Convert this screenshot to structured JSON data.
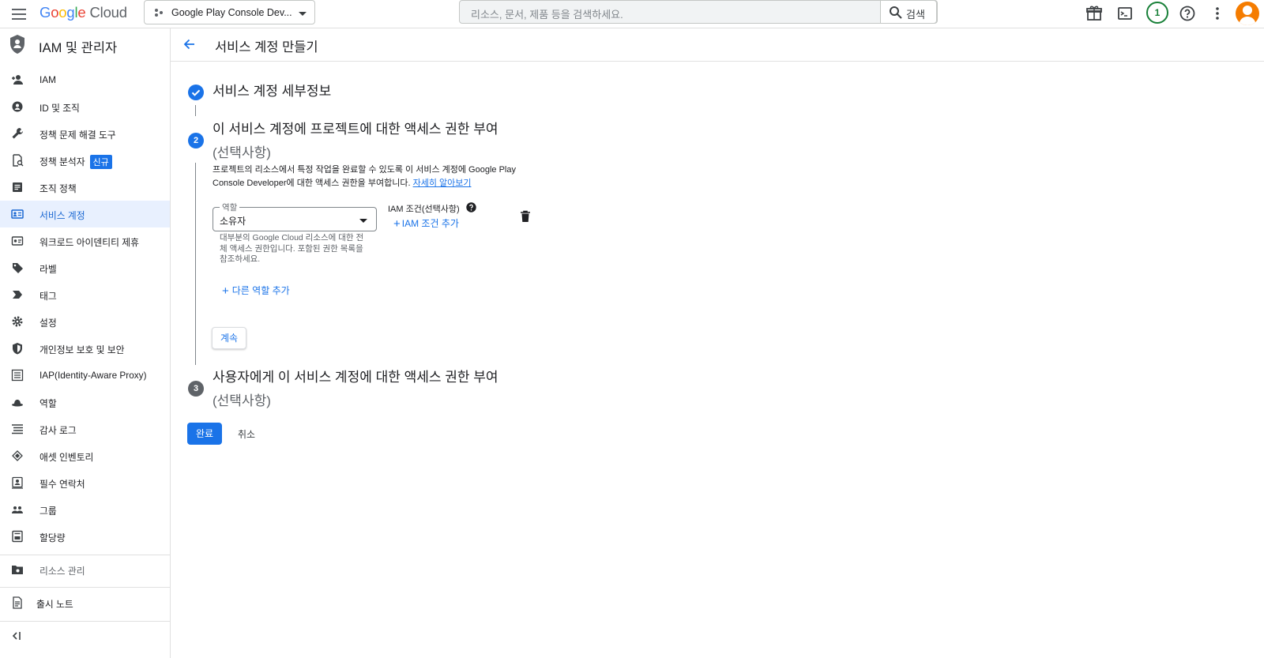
{
  "topbar": {
    "logo": {
      "g": "G",
      "o1": "o",
      "o2": "o",
      "g2": "g",
      "l": "l",
      "e": "e",
      "cloud": "Cloud"
    },
    "project_name": "Google Play Console Dev...",
    "search_placeholder": "리소스, 문서, 제품 등을 검색하세요.",
    "search_button": "검색",
    "notification_count": "1",
    "icons": [
      "menu-icon",
      "gift-icon",
      "terminal-icon",
      "help-icon",
      "more-vert-icon"
    ]
  },
  "sidebar": {
    "title": "IAM 및 관리자",
    "items": [
      {
        "label": "IAM",
        "icon": "person-add-icon"
      },
      {
        "label": "ID 및 조직",
        "icon": "account-circle-icon"
      },
      {
        "label": "정책 문제 해결 도구",
        "icon": "wrench-icon"
      },
      {
        "label": "정책 분석자",
        "icon": "policy-analyzer-icon",
        "badge": "신규"
      },
      {
        "label": "조직 정책",
        "icon": "article-icon"
      },
      {
        "label": "서비스 계정",
        "icon": "service-account-icon",
        "active": true
      },
      {
        "label": "워크로드 아이덴티티 제휴",
        "icon": "badge-icon"
      },
      {
        "label": "라벨",
        "icon": "label-icon"
      },
      {
        "label": "태그",
        "icon": "tag-icon"
      },
      {
        "label": "설정",
        "icon": "gear-icon"
      },
      {
        "label": "개인정보 보호 및 보안",
        "icon": "shield-icon"
      },
      {
        "label": "IAP(Identity-Aware Proxy)",
        "icon": "iap-icon"
      },
      {
        "label": "역할",
        "icon": "hat-icon"
      },
      {
        "label": "감사 로그",
        "icon": "list-icon"
      },
      {
        "label": "애셋 인벤토리",
        "icon": "diamond-icon"
      },
      {
        "label": "필수 연락처",
        "icon": "contact-icon"
      },
      {
        "label": "그룹",
        "icon": "group-icon"
      },
      {
        "label": "할당량",
        "icon": "quota-icon"
      }
    ],
    "resource_manager": "리소스 관리",
    "release_notes": "출시 노트",
    "collapse": "<|"
  },
  "main": {
    "page_title": "서비스 계정 만들기",
    "step1": {
      "title": "서비스 계정 세부정보"
    },
    "step2": {
      "number": "2",
      "title": "이 서비스 계정에 프로젝트에 대한 액세스 권한 부여",
      "subtitle": "(선택사항)",
      "description": "프로젝트의 리소스에서 특정 작업을 완료할 수 있도록 이 서비스 계정에 Google Play Console Developer에 대한 액세스 권한을 부여합니다.",
      "learn_more": "자세히 알아보기",
      "role_label": "역할",
      "role_value": "소유자",
      "role_help": "대부분의 Google Cloud 리소스에 대한 전체 액세스 권한입니다. 포함된 권한 목록을 참조하세요.",
      "iam_condition": "IAM 조건(선택사항)",
      "add_iam_condition": "IAM 조건 추가",
      "add_role": "다른 역할 추가",
      "continue": "계속"
    },
    "step3": {
      "number": "3",
      "title": "사용자에게 이 서비스 계정에 대한 액세스 권한 부여",
      "subtitle": "(선택사항)"
    },
    "done": "완료",
    "cancel": "취소"
  }
}
